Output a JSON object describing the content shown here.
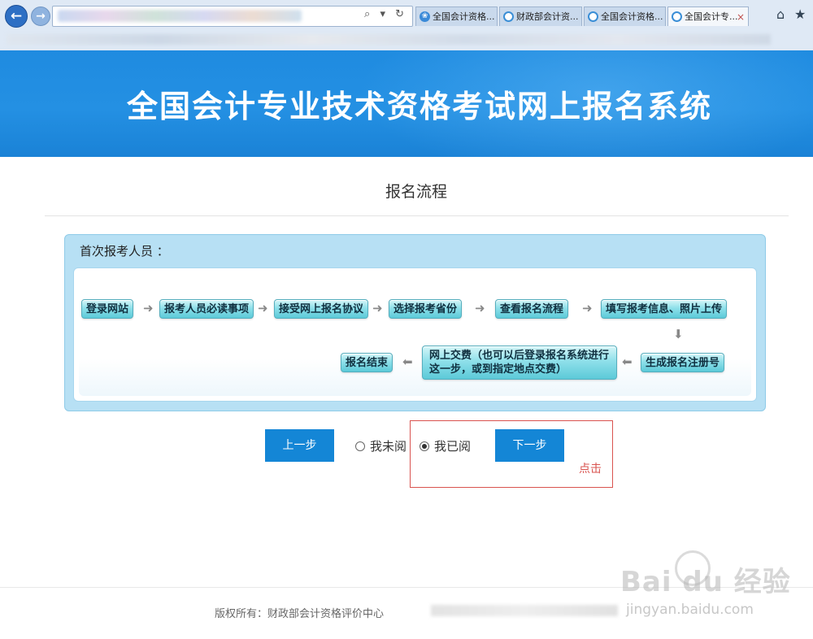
{
  "browser": {
    "back_icon": "arrow-left-icon",
    "forward_icon": "arrow-right-icon",
    "address_tools": "⌕ ▾ ↻",
    "tabs": [
      {
        "label": "全国会计资格...",
        "icon": "site-icon"
      },
      {
        "label": "财政部会计资...",
        "icon": "ie-icon"
      },
      {
        "label": "全国会计资格...",
        "icon": "ie-icon"
      },
      {
        "label": "全国会计专...",
        "icon": "ie-icon",
        "active": true
      }
    ],
    "tab_close": "×",
    "home_icon": "⌂",
    "favorites_icon": "★"
  },
  "banner": {
    "title": "全国会计专业技术资格考试网上报名系统"
  },
  "section": {
    "title": "报名流程"
  },
  "flow": {
    "label": "首次报考人员 ：",
    "steps": [
      "登录网站",
      "报考人员必读事项",
      "接受网上报名协议",
      "选择报考省份",
      "查看报名流程",
      "填写报考信息、照片上传",
      "生成报名注册号",
      "网上交费（也可以后登录报名系统进行这一步，或到指定地点交费）",
      "报名结束"
    ],
    "arrow_right": "➜",
    "arrow_left": "⬅",
    "arrow_down": "⬇"
  },
  "controls": {
    "prev_label": "上一步",
    "next_label": "下一步",
    "radio_unread": "我未阅",
    "radio_read": "我已阅",
    "selected": "我已阅",
    "annotation": "点击"
  },
  "footer": {
    "copyright": "版权所有：财政部会计资格评价中心"
  },
  "watermark": {
    "logo": "Bai du 经验",
    "url": "jingyan.baidu.com"
  },
  "colors": {
    "banner": "#2490e3",
    "button": "#1486d6",
    "annotation": "#d9534f",
    "step_fill": "#8fe0ea"
  }
}
